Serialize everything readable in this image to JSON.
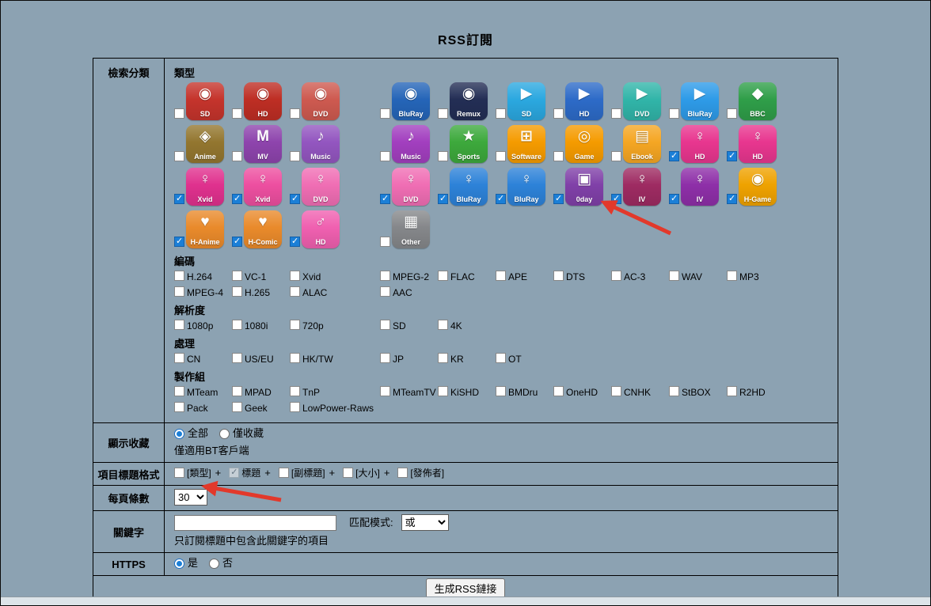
{
  "page": {
    "title": "RSS訂閱",
    "background": "#8CA2B2",
    "arrow_color": "#E2392B"
  },
  "category": {
    "row_label": "檢索分類",
    "section_label": "類型",
    "icon_rows": [
      {
        "left": [
          {
            "label": "SD",
            "color": "#C5342C",
            "glyph": "◉",
            "checked": false
          },
          {
            "label": "HD",
            "color": "#BE2E24",
            "glyph": "◉",
            "checked": false
          },
          {
            "label": "DVD",
            "color": "#CE5A50",
            "glyph": "◉",
            "checked": false
          }
        ],
        "right": [
          {
            "label": "BluRay",
            "color": "#2565B8",
            "glyph": "◉",
            "checked": false
          },
          {
            "label": "Remux",
            "color": "#232E55",
            "glyph": "◉",
            "checked": false
          },
          {
            "label": "SD",
            "color": "#2BA8E0",
            "glyph": "▶",
            "checked": false
          },
          {
            "label": "HD",
            "color": "#2D6BC8",
            "glyph": "▶",
            "checked": false
          },
          {
            "label": "DVD",
            "color": "#31B5A9",
            "glyph": "▶",
            "checked": false
          },
          {
            "label": "BluRay",
            "color": "#2E9BE8",
            "glyph": "▶",
            "checked": false
          },
          {
            "label": "BBC",
            "color": "#2F9E49",
            "glyph": "◆",
            "checked": false
          }
        ]
      },
      {
        "left": [
          {
            "label": "Anime",
            "color": "#93762F",
            "glyph": "◈",
            "checked": false
          },
          {
            "label": "MV",
            "color": "#8E44AD",
            "glyph": "M",
            "checked": false
          },
          {
            "label": "Music",
            "color": "#9356C0",
            "glyph": "♪",
            "checked": false
          }
        ],
        "right": [
          {
            "label": "Music",
            "color": "#A23FBF",
            "glyph": "♪",
            "checked": false
          },
          {
            "label": "Sports",
            "color": "#3DA93C",
            "glyph": "★",
            "checked": false
          },
          {
            "label": "Software",
            "color": "#F59B00",
            "glyph": "⊞",
            "checked": false
          },
          {
            "label": "Game",
            "color": "#F59B00",
            "glyph": "◎",
            "checked": false
          },
          {
            "label": "Ebook",
            "color": "#F5A623",
            "glyph": "▤",
            "checked": false
          },
          {
            "label": "HD",
            "color": "#E8368F",
            "glyph": "♀",
            "checked": true
          },
          {
            "label": "HD",
            "color": "#E8368F",
            "glyph": "♀",
            "checked": true
          }
        ]
      },
      {
        "left": [
          {
            "label": "Xvid",
            "color": "#E0318E",
            "glyph": "♀",
            "checked": true
          },
          {
            "label": "Xvid",
            "color": "#ED4FA0",
            "glyph": "♀",
            "checked": true
          },
          {
            "label": "DVD",
            "color": "#F06EB4",
            "glyph": "♀",
            "checked": true
          }
        ],
        "right": [
          {
            "label": "DVD",
            "color": "#F06EB4",
            "glyph": "♀",
            "checked": true
          },
          {
            "label": "BluRay",
            "color": "#2D82D8",
            "glyph": "♀",
            "checked": true
          },
          {
            "label": "BluRay",
            "color": "#2D82D8",
            "glyph": "♀",
            "checked": true
          },
          {
            "label": "0day",
            "color": "#8040A8",
            "glyph": "▣",
            "checked": true
          },
          {
            "label": "IV",
            "color": "#9E2B62",
            "glyph": "♀",
            "checked": true
          },
          {
            "label": "IV",
            "color": "#8E2FA8",
            "glyph": "♀",
            "checked": true
          },
          {
            "label": "H-Game",
            "color": "#EFA200",
            "glyph": "◉",
            "checked": true
          }
        ]
      },
      {
        "left": [
          {
            "label": "H-Anime",
            "color": "#E98A2B",
            "glyph": "♥",
            "checked": true
          },
          {
            "label": "H-Comic",
            "color": "#E98A2B",
            "glyph": "♥",
            "checked": true
          },
          {
            "label": "HD",
            "color": "#F060B0",
            "glyph": "♂",
            "checked": true
          }
        ],
        "right": [
          {
            "label": "Other",
            "color": "#85878A",
            "glyph": "▦",
            "checked": false
          }
        ]
      }
    ],
    "filter_groups": [
      {
        "label": "編碼",
        "lines": [
          {
            "left": [
              "H.264",
              "VC-1",
              "Xvid"
            ],
            "right": [
              "MPEG-2",
              "FLAC",
              "APE",
              "DTS",
              "AC-3",
              "WAV",
              "MP3"
            ]
          },
          {
            "left": [
              "MPEG-4",
              "H.265",
              "ALAC"
            ],
            "right": [
              "AAC"
            ]
          }
        ]
      },
      {
        "label": "解析度",
        "lines": [
          {
            "left": [
              "1080p",
              "1080i",
              "720p"
            ],
            "right": [
              "SD",
              "4K"
            ]
          }
        ]
      },
      {
        "label": "處理",
        "lines": [
          {
            "left": [
              "CN",
              "US/EU",
              "HK/TW"
            ],
            "right": [
              "JP",
              "KR",
              "OT"
            ]
          }
        ]
      },
      {
        "label": "製作組",
        "lines": [
          {
            "left": [
              "MTeam",
              "MPAD",
              "TnP"
            ],
            "right": [
              "MTeamTV",
              "KiSHD",
              "BMDru",
              "OneHD",
              "CNHK",
              "StBOX",
              "R2HD"
            ]
          },
          {
            "left": [
              "Pack",
              "Geek",
              "LowPower-Raws"
            ],
            "right": []
          }
        ]
      }
    ]
  },
  "favorites": {
    "row_label": "顯示收藏",
    "options": [
      {
        "label": "全部",
        "selected": true
      },
      {
        "label": "僅收藏",
        "selected": false
      }
    ],
    "note": "僅適用BT客戶端"
  },
  "title_format": {
    "row_label": "項目標題格式",
    "items": [
      {
        "label": "[類型]",
        "checked": false,
        "disabled": false,
        "sep": "+"
      },
      {
        "label": "標題",
        "checked": true,
        "disabled": true,
        "sep": "+"
      },
      {
        "label": "[副標題]",
        "checked": false,
        "disabled": false,
        "sep": "+"
      },
      {
        "label": "[大小]",
        "checked": false,
        "disabled": false,
        "sep": "+"
      },
      {
        "label": "[發佈者]",
        "checked": false,
        "disabled": false,
        "sep": ""
      }
    ]
  },
  "per_page": {
    "row_label": "每頁條數",
    "value": "30"
  },
  "keyword": {
    "row_label": "關鍵字",
    "value": "",
    "match_label": "匹配模式:",
    "match_value": "或",
    "note": "只訂閱標題中包含此關鍵字的項目"
  },
  "https": {
    "row_label": "HTTPS",
    "options": [
      {
        "label": "是",
        "selected": true
      },
      {
        "label": "否",
        "selected": false
      }
    ]
  },
  "submit": {
    "label": "生成RSS鏈接"
  }
}
